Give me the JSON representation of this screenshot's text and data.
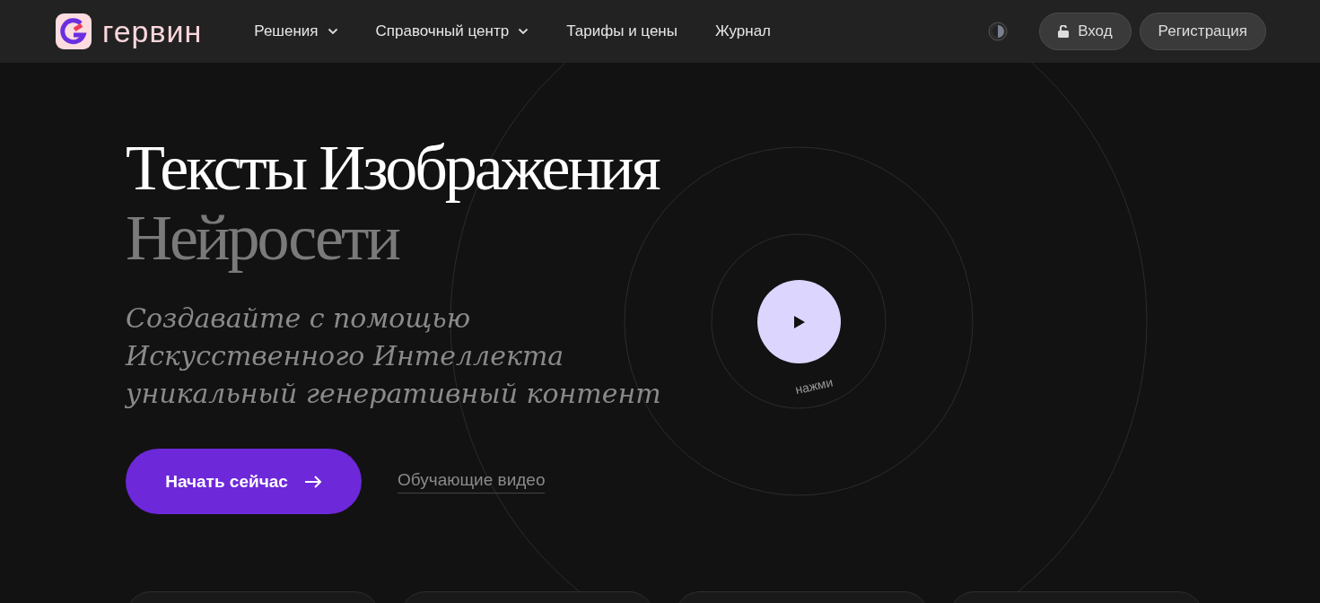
{
  "header": {
    "logo_text": "гервин",
    "nav": [
      {
        "label": "Решения",
        "kind": "dropdown"
      },
      {
        "label": "Справочный центр",
        "kind": "dropdown"
      },
      {
        "label": "Тарифы и цены",
        "kind": "link"
      },
      {
        "label": "Журнал",
        "kind": "link"
      }
    ],
    "login_button": "Вход",
    "register_button": "Регистрация"
  },
  "hero": {
    "title": "Тексты Изображения",
    "title_secondary": "Нейросети",
    "subtitle": "Создавайте с помощью Искусственного Интеллекта уникальный генеративный контент",
    "cta_button": "Начать сейчас",
    "video_link": "Обучающие видео",
    "play_hint": "нажми"
  }
}
